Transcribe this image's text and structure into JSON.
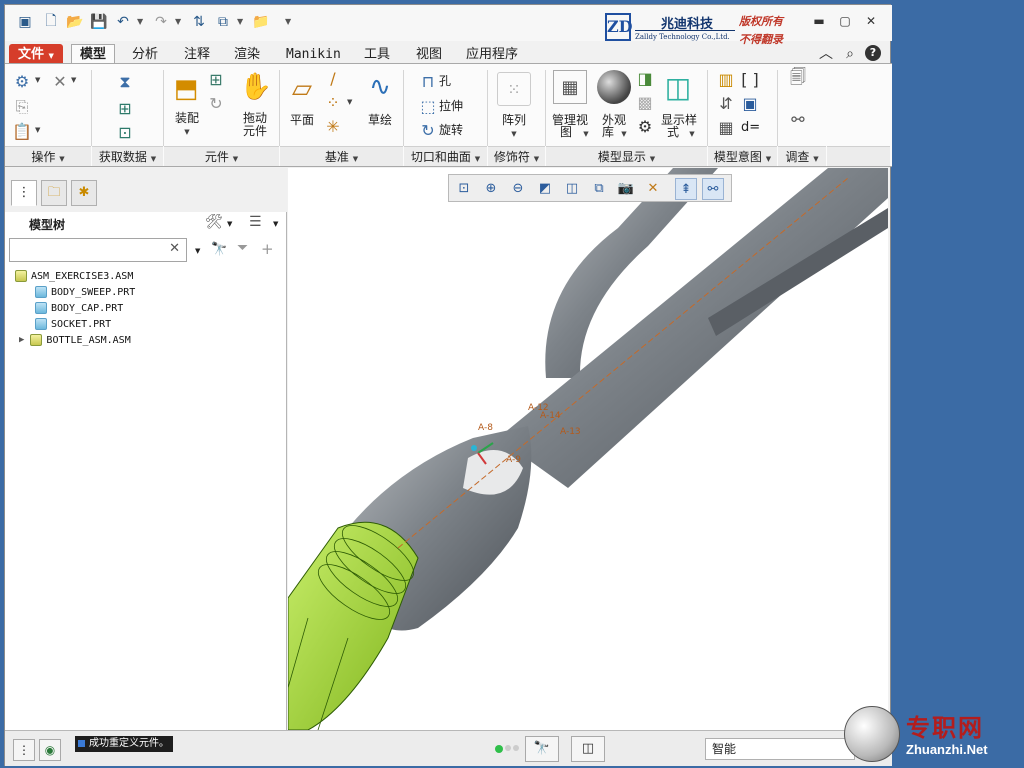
{
  "brand": {
    "cn_name": "兆迪科技",
    "en_name": "Zalldy Technology Co.,Ltd.",
    "right1": "版权所有",
    "right2": "不得翻录",
    "logo": "ZD"
  },
  "tabs": [
    "文件",
    "模型",
    "分析",
    "注释",
    "渲染",
    "Manikin",
    "工具",
    "视图",
    "应用程序"
  ],
  "active_tab": "模型",
  "ribbon": {
    "groups": [
      "操作",
      "获取数据",
      "元件",
      "基准",
      "切口和曲面",
      "修饰符",
      "模型显示",
      "模型意图",
      "调查"
    ],
    "buttons": {
      "assemble": "装配",
      "drag1": "拖动",
      "drag2": "元件",
      "plane": "平面",
      "sketch": "草绘",
      "hole": "孔",
      "extrude": "拉伸",
      "revolve": "旋转",
      "pattern": "阵列",
      "manage1": "管理视",
      "manage2": "图",
      "appear1": "外观",
      "appear2": "库",
      "display1": "显示样",
      "display2": "式",
      "d_eq": "d="
    }
  },
  "model_tree": {
    "title": "模型树",
    "search_value": "",
    "items": [
      {
        "name": "ASM_EXERCISE3.ASM",
        "type": "asm"
      },
      {
        "name": "BODY_SWEEP.PRT",
        "type": "prt"
      },
      {
        "name": "BODY_CAP.PRT",
        "type": "prt"
      },
      {
        "name": "SOCKET.PRT",
        "type": "prt"
      },
      {
        "name": "BOTTLE_ASM.ASM",
        "type": "asm"
      }
    ]
  },
  "viewport": {
    "annotations": [
      "A-12",
      "A-14",
      "A-8",
      "A-9",
      "A-13"
    ],
    "background": "#ffffff",
    "model_color": "#7f858b",
    "highlight_color": "#9cd02a"
  },
  "status": {
    "message": "成功重定义元件。",
    "filter": "智能"
  },
  "watermark": {
    "cn": "专职网",
    "en": "Zhuanzhi.Net"
  },
  "colors": {
    "accent": "#d63d2a",
    "desktop": "#3b6ba5"
  }
}
